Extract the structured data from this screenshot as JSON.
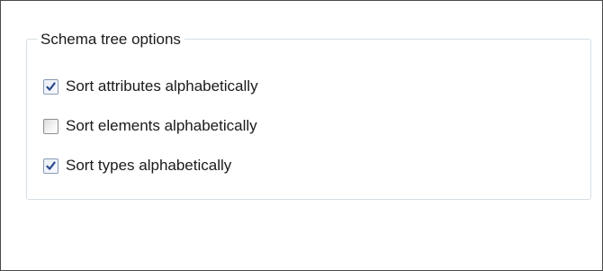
{
  "group": {
    "title": "Schema tree options"
  },
  "options": [
    {
      "label": "Sort attributes alphabetically",
      "checked": true
    },
    {
      "label": "Sort elements alphabetically",
      "checked": false
    },
    {
      "label": "Sort types alphabetically",
      "checked": true
    }
  ],
  "colors": {
    "check_mark": "#2b4a8c",
    "group_border": "#d5dfe5",
    "window_border": "#4a4a4a"
  }
}
